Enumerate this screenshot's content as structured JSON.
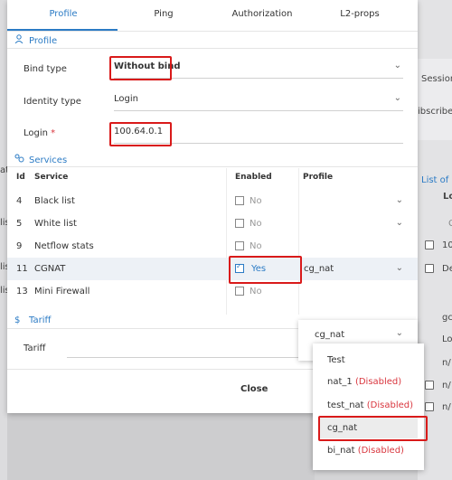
{
  "tabs": [
    "Profile",
    "Ping",
    "Authorization",
    "L2-props"
  ],
  "profile": {
    "heading": "Profile",
    "bind_type": {
      "label": "Bind type",
      "value": "Without bind"
    },
    "identity_type": {
      "label": "Identity type",
      "value": "Login"
    },
    "login": {
      "label": "Login",
      "required_mark": "*",
      "value": "100.64.0.1"
    }
  },
  "services": {
    "heading": "Services",
    "columns": [
      "Id",
      "Service",
      "Enabled",
      "Profile"
    ],
    "rows": [
      {
        "id": "4",
        "service": "Black list",
        "enabled": false,
        "enabled_text": "No",
        "profile": "",
        "has_select": true
      },
      {
        "id": "5",
        "service": "White list",
        "enabled": false,
        "enabled_text": "No",
        "profile": "",
        "has_select": true
      },
      {
        "id": "9",
        "service": "Netflow stats",
        "enabled": false,
        "enabled_text": "No",
        "profile": "",
        "has_select": false
      },
      {
        "id": "11",
        "service": "CGNAT",
        "enabled": true,
        "enabled_text": "Yes",
        "profile": "cg_nat",
        "has_select": true
      },
      {
        "id": "13",
        "service": "Mini Firewall",
        "enabled": false,
        "enabled_text": "No",
        "profile": "",
        "has_select": false
      }
    ]
  },
  "tariff": {
    "heading": "Tariff",
    "label": "Tariff",
    "value": ""
  },
  "footer": {
    "close_label": "Close"
  },
  "profile_select": {
    "value": "cg_nat"
  },
  "profile_dropdown": {
    "options": [
      {
        "label": "Test",
        "suffix": ""
      },
      {
        "label": "nat_1",
        "suffix": "(Disabled)"
      },
      {
        "label": "test_nat",
        "suffix": "(Disabled)"
      },
      {
        "label": "cg_nat",
        "suffix": ""
      },
      {
        "label": "bi_nat",
        "suffix": "(Disabled)"
      }
    ],
    "selected": "cg_nat"
  },
  "background": {
    "texts": [
      "Session",
      "ibscribers",
      "List of s",
      "Lo",
      "10",
      "De",
      "gc",
      "Lo",
      "n/",
      "n/",
      "n/",
      "wt",
      "at",
      "lis",
      "lis",
      "lis",
      "C"
    ]
  },
  "colors": {
    "accent": "#2b7bc5",
    "highlight": "#d91a1a",
    "disabled": "#d9363e"
  }
}
